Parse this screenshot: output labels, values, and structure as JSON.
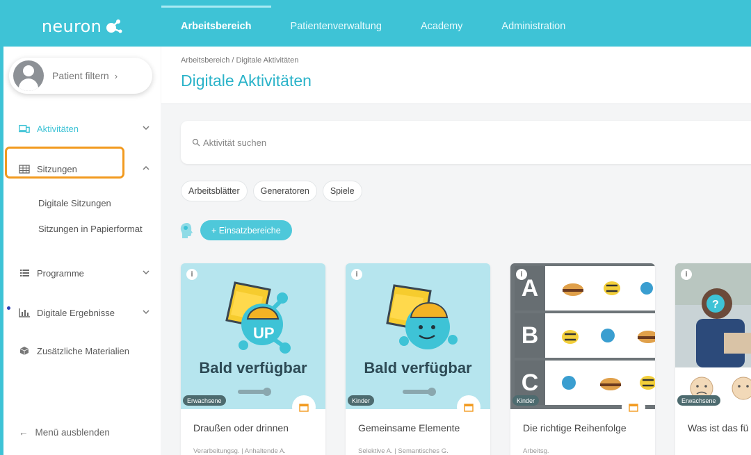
{
  "app": {
    "logo_text": "neuron"
  },
  "topnav": [
    {
      "label": "Arbeitsbereich",
      "active": true
    },
    {
      "label": "Patientenverwaltung",
      "active": false
    },
    {
      "label": "Academy",
      "active": false
    },
    {
      "label": "Administration",
      "active": false
    }
  ],
  "sidebar": {
    "patient_filter": "Patient filtern",
    "items": [
      {
        "label": "Aktivitäten",
        "icon": "devices-icon"
      },
      {
        "label": "Sitzungen",
        "icon": "grid-icon"
      },
      {
        "label": "Programme",
        "icon": "list-icon"
      },
      {
        "label": "Digitale Ergebnisse",
        "icon": "chart-icon"
      },
      {
        "label": "Zusätzliche Materialien",
        "icon": "box-icon"
      }
    ],
    "sub_items": [
      "Digitale Sitzungen",
      "Sitzungen in Papierformat"
    ],
    "footer": "Menü ausblenden"
  },
  "header": {
    "breadcrumb": "Arbeitsbereich / Digitale Aktivitäten",
    "title": "Digitale Aktivitäten"
  },
  "search": {
    "placeholder": "Aktivität suchen"
  },
  "chips": [
    "Arbeitsblätter",
    "Generatoren",
    "Spiele"
  ],
  "einsatz_button": "+ Einsatzbereiche",
  "cards": [
    {
      "title": "Draußen oder drinnen",
      "tags": "Verarbeitungsg. | Anhaltende A.",
      "badge": "Erwachsene",
      "overlay": "Bald verfügbar"
    },
    {
      "title": "Gemeinsame Elemente",
      "tags": "Selektive A. | Semantisches G.",
      "badge": "Kinder",
      "overlay": "Bald verfügbar"
    },
    {
      "title": "Die richtige Reihenfolge",
      "tags": "Arbeitsg.",
      "badge": "Kinder",
      "letters": [
        "A",
        "B",
        "C"
      ]
    },
    {
      "title": "Was ist das fü Gesichtsausdr",
      "tags": "",
      "badge": "Erwachsene"
    }
  ],
  "colors": {
    "brand": "#3ec3d6",
    "highlight": "#f29a1f",
    "title": "#2bb3c9"
  }
}
